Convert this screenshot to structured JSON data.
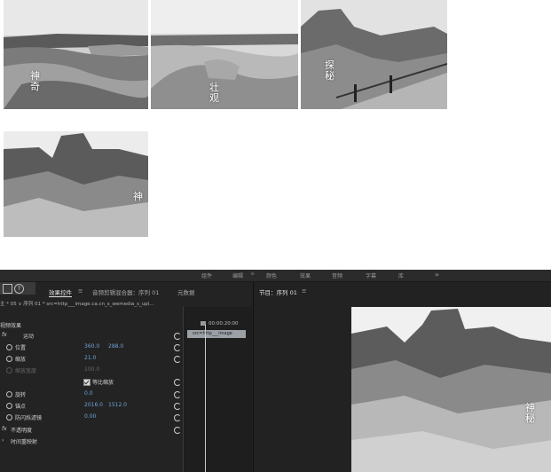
{
  "thumbnails": [
    {
      "caption": "神\n奇",
      "icon": "landscape-badlands-river"
    },
    {
      "caption": "壮\n观",
      "icon": "landscape-badlands-ridge"
    },
    {
      "caption": "探\n秘",
      "icon": "landscape-rock-boardwalk"
    },
    {
      "caption": "神",
      "icon": "landscape-rock-cliff"
    }
  ],
  "workspaces": [
    "组件",
    "编辑",
    "颜色",
    "效果",
    "音频",
    "字幕",
    "库"
  ],
  "workspace_overflow": "»",
  "menu_glyph": "≡",
  "left_tabs": {
    "effect_controls": "效果控件",
    "audio_mixer": "音频剪辑混合器：序列 01",
    "metadata": "元数据"
  },
  "seq_row": "主 * 05  ∨  序列 01 * src=http___image.ca.cn_s_wemedia_s_upl...",
  "video_effects_label": "视频效果",
  "motion": {
    "label": "运动",
    "position_label": "位置",
    "position_x": "360.0",
    "position_y": "288.0",
    "scale_label": "缩放",
    "scale_value": "21.0",
    "scale_width_label": "缩放宽度",
    "scale_width_value": "100.0",
    "uniform_label": "等比缩放",
    "rotation_label": "旋转",
    "rotation_value": "0.0",
    "anchor_label": "锚点",
    "anchor_x": "2016.0",
    "anchor_y": "1512.0",
    "flicker_label": "防闪烁滤镜",
    "flicker_value": "0.00"
  },
  "opacity_label": "不透明度",
  "timeremap_label": "时间重映射",
  "timeline": {
    "timecode": "00:00:20:00",
    "clip_label": "src=http___image"
  },
  "program": {
    "title": "节目：序列 01",
    "caption": "神\n秘"
  },
  "colors": {
    "panel_bg": "#232323",
    "value_blue": "#6fa3d8",
    "text": "#d0d0d0"
  }
}
